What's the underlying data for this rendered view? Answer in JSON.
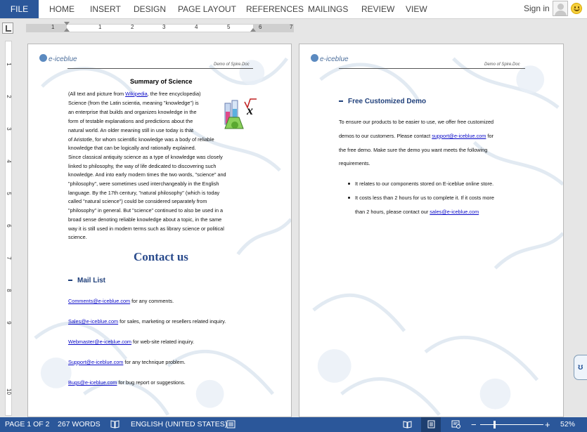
{
  "ribbon": {
    "tabs": [
      {
        "label": "FILE"
      },
      {
        "label": "HOME"
      },
      {
        "label": "INSERT"
      },
      {
        "label": "DESIGN"
      },
      {
        "label": "PAGE LAYOUT"
      },
      {
        "label": "REFERENCES"
      },
      {
        "label": "MAILINGS"
      },
      {
        "label": "REVIEW"
      },
      {
        "label": "VIEW"
      }
    ],
    "sign_in": "Sign in"
  },
  "ruler": {
    "horizontal_numbers": [
      "1",
      "1",
      "2",
      "3",
      "4",
      "5",
      "6",
      "7"
    ],
    "vertical_numbers": [
      "1",
      "2",
      "3",
      "4",
      "5",
      "6",
      "7",
      "8",
      "9",
      "10"
    ]
  },
  "page1": {
    "logo_text": "e-iceblue",
    "header_text": "Demo of Spire.Doc",
    "title": "Summary of Science",
    "intro": {
      "before": "(All text and picture from ",
      "link": "Wikipedia",
      "after": ", the free encyclopedia)"
    },
    "body_lines": [
      "Science (from the Latin scientia, meaning \"knowledge\") is",
      "an enterprise that builds and organizes knowledge in the",
      "form of testable explanations and predictions about the",
      "natural world. An older meaning still in use today is that",
      "of Aristotle, for whom scientific knowledge was a body of reliable",
      "knowledge that can be logically and rationally explained.",
      "Since classical antiquity science as a type of knowledge was closely",
      "linked to philosophy, the way of life dedicated to discovering such",
      "knowledge. And into early modern times the two words, \"science\" and",
      "\"philosophy\", were sometimes used interchangeably in the English",
      "language. By the 17th century, \"natural philosophy\" (which is today",
      "called \"natural science\") could be considered separately from",
      "\"philosophy\" in general. But \"science\" continued to also be used in a",
      "broad sense denoting reliable knowledge about a topic, in the same",
      "way it is still used in modern terms such as library science or political",
      "science."
    ],
    "contact_heading": "Contact us",
    "mail_list_heading": "Mail List",
    "mail_items": [
      {
        "email": "Comments@e-iceblue.com",
        "desc": " for any comments."
      },
      {
        "email": "Sales@e-iceblue.com",
        "desc": " for sales, marketing or resellers related inquiry."
      },
      {
        "email": "Webmaster@e-iceblue.com",
        "desc": " for web-site related inquiry."
      },
      {
        "email": "Support@e-iceblue.com",
        "desc": " for any technique problem."
      },
      {
        "email": "Bugs@e-iceblue.com",
        "desc": " for bug report or suggestions."
      }
    ]
  },
  "page2": {
    "logo_text": "e-iceblue",
    "header_text": "Demo of Spire.Doc",
    "heading": "Free Customized Demo",
    "para_lines": [
      "To ensure our products to be easier to use, we offer free customized",
      "demos to our customers. Please contact ",
      "the free demo. Make sure the demo you want meets the following",
      "requirements."
    ],
    "para_link": "support@e-iceblue.com",
    "para_link_after": " for",
    "bullets": [
      "It relates to our components stored on E-iceblue online store.",
      "It costs less than 2 hours for us to complete it. If it costs more"
    ],
    "bullet2_cont_before": "than 2 hours, please contact our ",
    "bullet2_link": "sales@e-iceblue.com"
  },
  "statusbar": {
    "page": "PAGE 1 OF 2",
    "words": "267 WORDS",
    "language": "ENGLISH (UNITED STATES)",
    "zoom": "52%",
    "zoom_minus": "−",
    "zoom_plus": "+"
  },
  "colors": {
    "accent": "#2b579a",
    "heading_blue": "#2a4b8c",
    "link": "#0a0ac8"
  }
}
